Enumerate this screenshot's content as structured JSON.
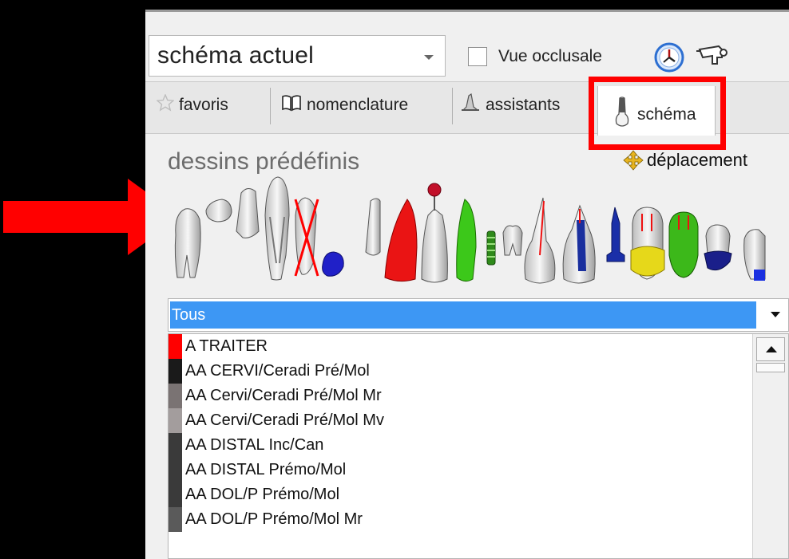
{
  "toolbar": {
    "view_select_value": "schéma actuel",
    "occlusal_checkbox_label": "Vue occlusale",
    "occlusal_checked": false
  },
  "tabs": [
    {
      "label": "favoris",
      "icon": "star-icon"
    },
    {
      "label": "nomenclature",
      "icon": "book-icon"
    },
    {
      "label": "assistants",
      "icon": "wizard-hat-icon"
    },
    {
      "label": "schéma",
      "icon": "tooth-icon",
      "active": true
    }
  ],
  "drawings": {
    "title": "dessins prédéfinis",
    "move_label": "déplacement"
  },
  "filter": {
    "selected": "Tous"
  },
  "list": {
    "items": [
      {
        "label": "A TRAITER",
        "color": "#ff0000"
      },
      {
        "label": "AA CERVI/Ceradi Pré/Mol",
        "color": "#1a1a1a"
      },
      {
        "label": "AA Cervi/Ceradi Pré/Mol Mr",
        "color": "#7a7373"
      },
      {
        "label": "AA Cervi/Ceradi Pré/Mol Mv",
        "color": "#a39d9d"
      },
      {
        "label": "AA DISTAL Inc/Can",
        "color": "#3a3a3a"
      },
      {
        "label": "AA DISTAL Prémo/Mol",
        "color": "#3a3a3a"
      },
      {
        "label": "AA DOL/P Prémo/Mol",
        "color": "#3a3a3a"
      },
      {
        "label": "AA DOL/P Prémo/Mol Mr",
        "color": "#5a5a5a"
      }
    ]
  },
  "colors": {
    "highlight_red": "#ff0000",
    "selection_blue": "#3d97f4"
  }
}
